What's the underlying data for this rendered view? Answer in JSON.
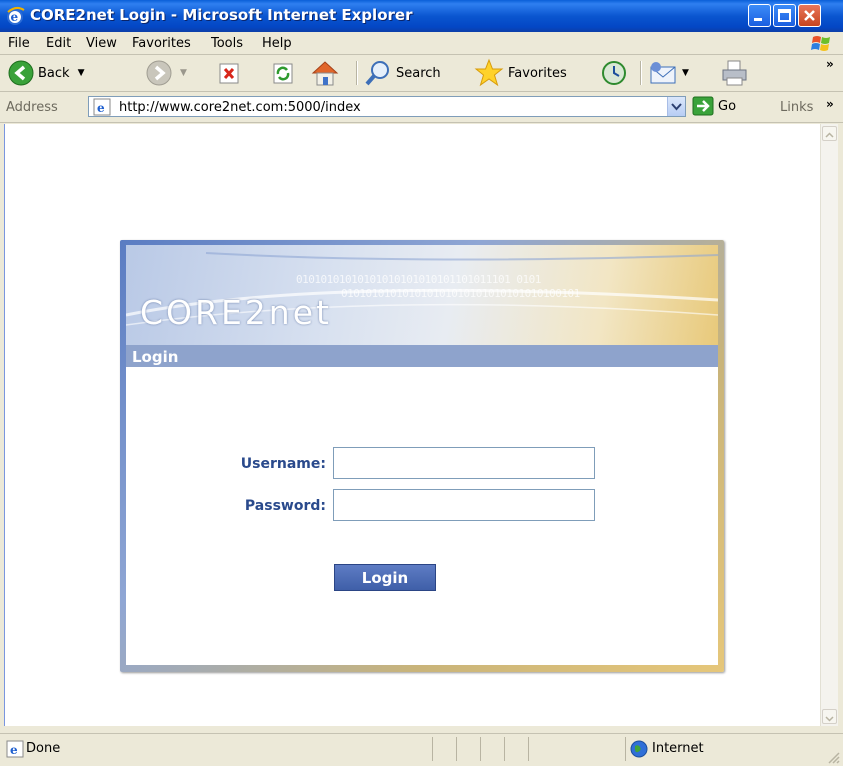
{
  "window": {
    "title": "CORE2net Login - Microsoft Internet Explorer"
  },
  "menubar": {
    "items": [
      {
        "label": "File"
      },
      {
        "label": "Edit"
      },
      {
        "label": "View"
      },
      {
        "label": "Favorites"
      },
      {
        "label": "Tools"
      },
      {
        "label": "Help"
      }
    ]
  },
  "toolbar": {
    "back_label": "Back",
    "search_label": "Search",
    "favorites_label": "Favorites",
    "overflow_label": "»"
  },
  "addressbar": {
    "label": "Address",
    "url": "http://www.core2net.com:5000/index",
    "go_label": "Go",
    "links_label": "Links",
    "links_overflow": "»"
  },
  "page": {
    "brand": "CORE2net",
    "binary_row1": "01010101010101010101010101101011101 0101",
    "binary_row2": "010101010101010101010101010101010100101",
    "section_title": "Login",
    "username_label": "Username:",
    "username_value": "",
    "password_label": "Password:",
    "password_value": "",
    "login_button": "Login"
  },
  "statusbar": {
    "status": "Done",
    "zone": "Internet"
  },
  "colors": {
    "titlebar": "#0a56d0",
    "panel_header": "#8ea3cc",
    "label_blue": "#2a4a8c",
    "button_blue": "#4a6ab4"
  }
}
